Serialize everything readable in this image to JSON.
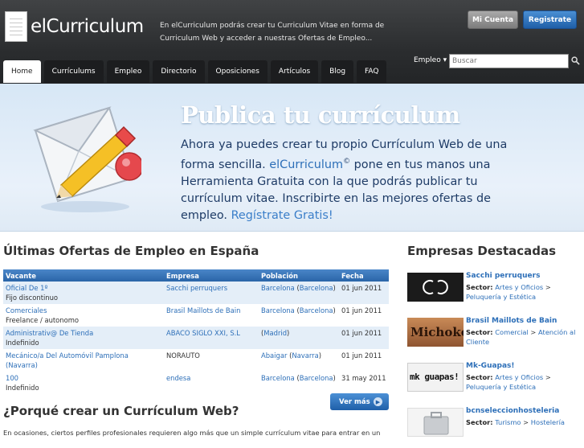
{
  "header": {
    "logo_text": "elCurriculum",
    "tagline": "En elCurriculum podrás crear tu Curriculum Vitae en forma de Curriculum Web y acceder a nuestras Ofertas de Empleo...",
    "mi_cuenta": "Mi Cuenta",
    "registrate": "Registrate",
    "empleo_dropdown": "Empleo ▾",
    "search_placeholder": "Buscar"
  },
  "nav": {
    "tabs": [
      "Home",
      "Currículums",
      "Empleo",
      "Directorio",
      "Oposiciones",
      "Artículos",
      "Blog",
      "FAQ"
    ],
    "active": "Home"
  },
  "hero": {
    "title": "Publica tu currículum",
    "text_1": "Ahora ya puedes crear tu propio Currículum Web de una forma sencilla. ",
    "brand": "elCurriculum",
    "reg_mark": "©",
    "text_2": " pone en tus manos una Herramienta Gratuita con la que podrás publicar tu currículum vitae. Inscribirte en las mejores ofertas de empleo. ",
    "link": "Regístrate Gratis!"
  },
  "ofertas": {
    "title": "Últimas Ofertas de Empleo en España",
    "headers": [
      "Vacante",
      "Empresa",
      "Población",
      "Fecha"
    ],
    "rows": [
      {
        "vacante": "Oficial De 1º",
        "sub": "Fijo discontinuo",
        "empresa": "Sacchi perruquers",
        "city": "Barcelona",
        "prov": "Barcelona",
        "fecha": "01 jun 2011"
      },
      {
        "vacante": "Comerciales",
        "sub": "Freelance / autonomo",
        "empresa": "Brasil Maillots de Bain",
        "city": "Barcelona",
        "prov": "Barcelona",
        "fecha": "01 jun 2011"
      },
      {
        "vacante": "Administrativ@ De Tienda",
        "sub": "Indefinido",
        "empresa": "ABACO SIGLO XXI, S.L",
        "city": "",
        "prov": "Madrid",
        "fecha": "01 jun 2011"
      },
      {
        "vacante": "Mecánico/a Del Automóvil Pamplona (Navarra)",
        "sub": "",
        "empresa": "NORAUTO",
        "city": "Abaigar",
        "prov": "Navarra",
        "fecha": "01 jun 2011"
      },
      {
        "vacante": "100",
        "sub": "Indefinido",
        "empresa": "endesa",
        "city": "Barcelona",
        "prov": "Barcelona",
        "fecha": "31 may 2011"
      }
    ],
    "ver_mas": "Ver más"
  },
  "porque": {
    "title": "¿Porqué crear un Currículum Web?",
    "text": "En ocasiones, ciertos perfiles profesionales requieren algo más que un simple currículum vitae para entrar en un"
  },
  "empresas": {
    "title": "Empresas Destacadas",
    "sector_label": "Sector:",
    "items": [
      {
        "name": "Sacchi perruquers",
        "sector_a": "Artes y Oficios",
        "sector_b": "Peluquería y Estética"
      },
      {
        "name": "Brasil Maillots de Bain",
        "sector_a": "Comercial",
        "sector_b": "Atención al Cliente"
      },
      {
        "name": "Mk-Guapas!",
        "sector_a": "Artes y Oficios",
        "sector_b": "Peluquería y Estética"
      },
      {
        "name": "bcnseleccionhosteleria",
        "sector_a": "Turismo",
        "sector_b": "Hostelería"
      }
    ],
    "logo_texts": [
      "Michoko",
      "mk guapas!"
    ]
  }
}
